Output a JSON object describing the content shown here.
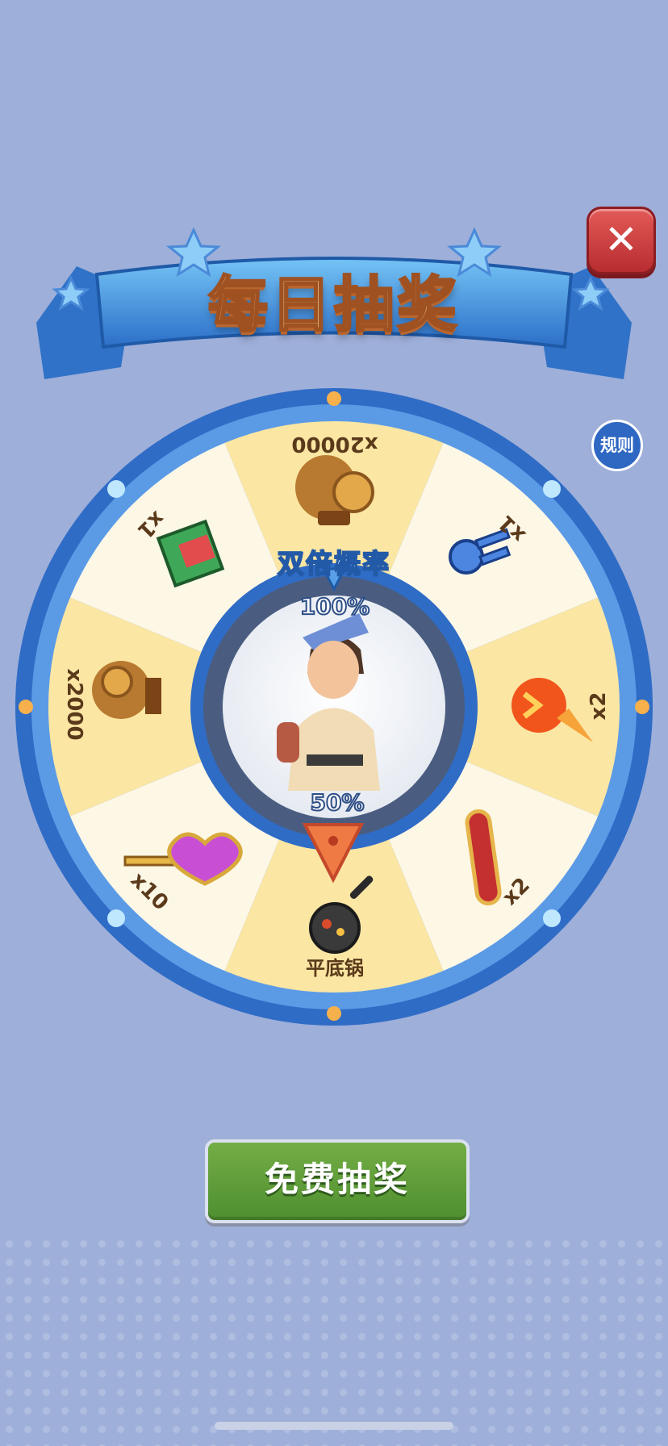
{
  "title": "每日抽奖",
  "close_icon": "close-icon",
  "rules_label": "规则",
  "multiplier_label": "双倍概率",
  "pct_top": "100%",
  "pct_bottom": "50%",
  "prizes": [
    {
      "label": "x20000",
      "icon": "gold-coin-bags-icon"
    },
    {
      "label": "x1",
      "icon": "keys-icon"
    },
    {
      "label": "x2",
      "icon": "flame-boost-icon"
    },
    {
      "label": "x2",
      "icon": "red-board-icon"
    },
    {
      "label": "平底锅",
      "icon": "frying-pan-icon"
    },
    {
      "label": "x10",
      "icon": "heart-key-icon"
    },
    {
      "label": "x2000",
      "icon": "gold-coin-bag-icon"
    },
    {
      "label": "x1",
      "icon": "mystery-box-icon"
    }
  ],
  "spin_button_label": "免费抽奖",
  "colors": {
    "background": "#9eafd9",
    "wheel_rim": "#3c7fd6",
    "segment_yellow": "#fbe6a4",
    "segment_cream": "#fdf7e6",
    "spin_button": "#5e9c38",
    "close_button": "#c9393a"
  }
}
